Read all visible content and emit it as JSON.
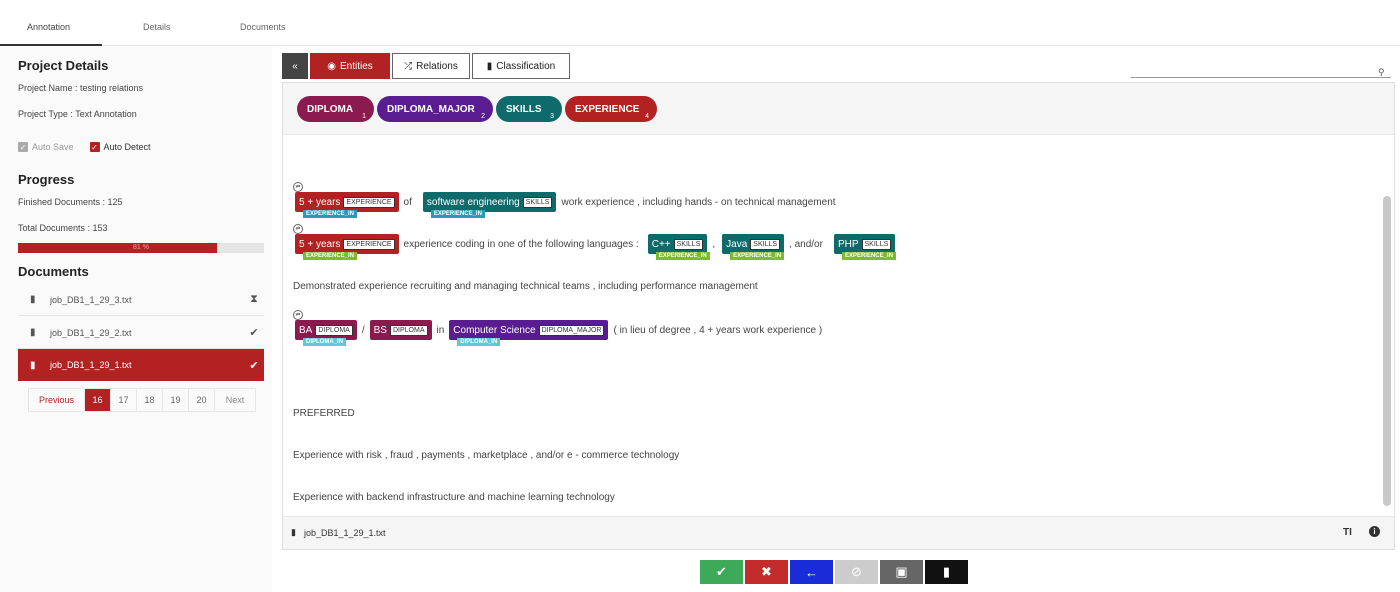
{
  "tabs": [
    "Annotation",
    "Details",
    "Documents"
  ],
  "project": {
    "heading": "Project Details",
    "name": "Project Name : testing relations",
    "type": "Project Type : Text Annotation",
    "auto_save": "Auto Save",
    "auto_detect": "Auto Detect"
  },
  "progress": {
    "heading": "Progress",
    "finished": "Finished Documents : 125",
    "total": "Total Documents : 153",
    "percent_label": "81 %",
    "percent": 81
  },
  "documents": {
    "heading": "Documents",
    "items": [
      {
        "name": "job_DB1_1_29_3.txt",
        "status": "⧗"
      },
      {
        "name": "job_DB1_1_29_2.txt",
        "status": "✔"
      },
      {
        "name": "job_DB1_1_29_1.txt",
        "status": "✔"
      }
    ]
  },
  "pager": {
    "previous": "Previous",
    "pages": [
      "16",
      "17",
      "18",
      "19",
      "20"
    ],
    "active": "16",
    "next": "Next"
  },
  "toolbar": {
    "entities": "Entities",
    "relations": "Relations",
    "classification": "Classification"
  },
  "labels": [
    {
      "name": "DIPLOMA",
      "key": "1",
      "color": "#8b1a4e"
    },
    {
      "name": "DIPLOMA_MAJOR",
      "key": "2",
      "color": "#5a1d91"
    },
    {
      "name": "SKILLS",
      "key": "3",
      "color": "#0f6b6b"
    },
    {
      "name": "EXPERIENCE",
      "key": "4",
      "color": "#b22222"
    }
  ],
  "text": {
    "l1": {
      "e1": "5 + years",
      "t1": "EXPERIENCE",
      "r1": "EXPERIENCE_IN",
      "p1": "of",
      "e2": "software engineering",
      "t2": "SKILLS",
      "r2": "EXPERIENCE_IN",
      "p2": "work experience , including hands - on technical management"
    },
    "l2": {
      "e1": "5 + years",
      "t1": "EXPERIENCE",
      "r1": "EXPERIENCE_IN",
      "p1": "experience coding in one of the following languages :",
      "e2": "C++",
      "t2": "SKILLS",
      "r2": "EXPERIENCE_IN",
      "p2": ",",
      "e3": "Java",
      "t3": "SKILLS",
      "r3": "EXPERIENCE_IN",
      "p3": ", and/or",
      "e4": "PHP",
      "t4": "SKILLS",
      "r4": "EXPERIENCE_IN"
    },
    "l3": "Demonstrated experience recruiting and managing technical teams , including performance management",
    "l4": {
      "e1": "BA",
      "t1": "DIPLOMA",
      "r1": "DIPLOMA_IN",
      "p1": "/",
      "e2": "BS",
      "t2": "DIPLOMA",
      "p2": "in",
      "e3": "Computer Science",
      "t3": "DIPLOMA_MAJOR",
      "r3": "DIPLOMA_IN",
      "p3": "( in lieu of degree , 4 + years work experience )"
    },
    "l5": "PREFERRED",
    "l6": "Experience with risk , fraud , payments , marketplace , and/or e - commerce technology",
    "l7": "Experience with backend infrastructure and machine learning technology"
  },
  "footer": {
    "file": "job_DB1_1_29_1.txt",
    "text_icon": "TI"
  },
  "actions": [
    "accept-icon",
    "reject-icon",
    "back-arrow-icon",
    "block-icon",
    "save-icon",
    "delete-icon"
  ]
}
